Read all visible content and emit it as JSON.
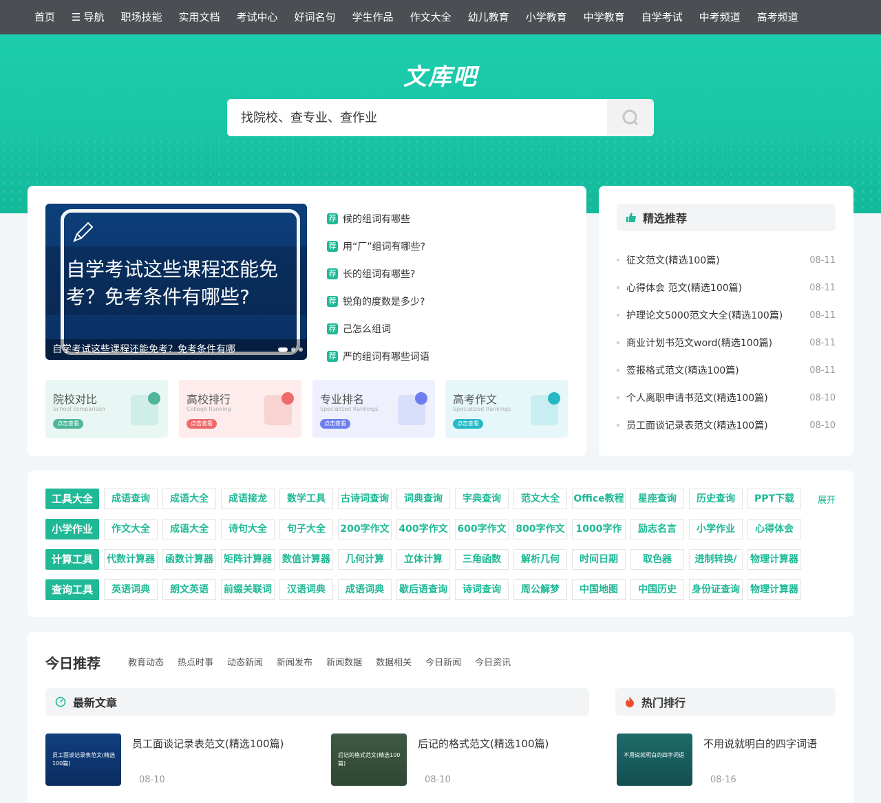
{
  "nav": [
    "首页",
    "导航",
    "职场技能",
    "实用文档",
    "考试中心",
    "好词名句",
    "学生作品",
    "作文大全",
    "幼儿教育",
    "小学教育",
    "中学教育",
    "自学考试",
    "中考频道",
    "高考频道"
  ],
  "nav_menu_glyph": "☰",
  "logo": "文库吧",
  "search": {
    "placeholder": "找院校、查专业、查作业"
  },
  "banner": {
    "big_title": "自学考试这些课程还能免考？免考条件有哪些?",
    "caption": "自学考试这些课程还能免考？免考条件有哪"
  },
  "recommend_tag": "荐",
  "recommend": [
    "候的组词有哪些",
    "用“厂”组词有哪些?",
    "长的组词有哪些?",
    "锐角的度数是多少?",
    "己怎么组词",
    "严的组词有哪些词语"
  ],
  "quick": [
    {
      "title": "院校对比",
      "sub": "School comparison",
      "btn": "点击查看",
      "color": "#4fb59b",
      "bg": "#e8f7f3"
    },
    {
      "title": "高校排行",
      "sub": "College Ranking",
      "btn": "点击查看",
      "color": "#ee6b6b",
      "bg": "#fdeceb"
    },
    {
      "title": "专业排名",
      "sub": "Specialized Rankings",
      "btn": "点击查看",
      "color": "#6d7ff0",
      "bg": "#eef0fd"
    },
    {
      "title": "高考作文",
      "sub": "Specialized Rankings",
      "btn": "点击查看",
      "color": "#27b8c5",
      "bg": "#e5f7f8"
    }
  ],
  "side": {
    "title": "精选推荐",
    "items": [
      {
        "title": "征文范文(精选100篇)",
        "date": "08-11"
      },
      {
        "title": "心得体会 范文(精选100篇)",
        "date": "08-11"
      },
      {
        "title": "护理论文5000范文大全(精选100篇)",
        "date": "08-11"
      },
      {
        "title": "商业计划书范文word(精选100篇)",
        "date": "08-11"
      },
      {
        "title": "签报格式范文(精选100篇)",
        "date": "08-11"
      },
      {
        "title": "个人离职申请书范文(精选100篇)",
        "date": "08-10"
      },
      {
        "title": "员工面谈记录表范文(精选100篇)",
        "date": "08-10"
      }
    ]
  },
  "tools": {
    "expand": "展开",
    "rows": [
      {
        "head": "工具大全",
        "items": [
          "成语查询",
          "成语大全",
          "成语接龙",
          "数学工具",
          "古诗词查询",
          "词典查询",
          "字典查询",
          "范文大全",
          "Office教程",
          "星座查询",
          "历史查询",
          "PPT下载"
        ]
      },
      {
        "head": "小学作业",
        "items": [
          "作文大全",
          "成语大全",
          "诗句大全",
          "句子大全",
          "200字作文",
          "400字作文",
          "600字作文",
          "800字作文",
          "1000字作",
          "励志名言",
          "小学作业",
          "心得体会"
        ]
      },
      {
        "head": "计算工具",
        "items": [
          "代数计算器",
          "函数计算器",
          "矩阵计算器",
          "数值计算器",
          "几何计算",
          "立体计算",
          "三角函数",
          "解析几何",
          "时间日期",
          "取色器",
          "进制转换/",
          "物理计算器"
        ]
      },
      {
        "head": "查询工具",
        "items": [
          "英语词典",
          "朗文英语",
          "前缀关联词",
          "汉语词典",
          "成语词典",
          "歇后语查询",
          "诗词查询",
          "周公解梦",
          "中国地图",
          "中国历史",
          "身份证查询",
          "物理计算器"
        ]
      }
    ]
  },
  "today": {
    "title": "今日推荐",
    "tabs": [
      "教育动态",
      "热点时事",
      "动态新闻",
      "新闻发布",
      "新闻数据",
      "数据相关",
      "今日新闻",
      "今日资讯"
    ],
    "latest_title": "最新文章",
    "hot_title": "热门排行",
    "articles": [
      {
        "title": "员工面谈记录表范文(精选100篇)",
        "thumb_text": "员工面谈记录表范文(精选100篇)",
        "date": "08-10"
      },
      {
        "title": "后记的格式范文(精选100篇)",
        "thumb_text": "后记的格式范文(精选100篇)",
        "date": "08-10"
      },
      {
        "title": "不用说就明白的四字词语",
        "thumb_text": "不用说就明白的四字词语",
        "date": "08-16"
      }
    ]
  },
  "colors": {
    "accent": "#1fb996",
    "nav_bg": "#4b4f53"
  }
}
